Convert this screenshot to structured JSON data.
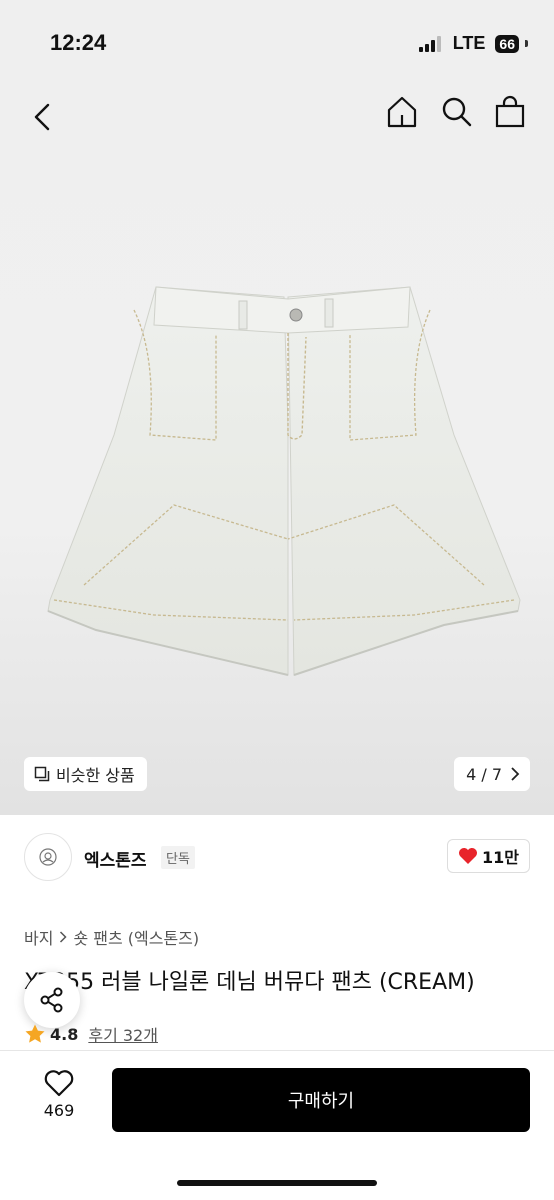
{
  "status_bar": {
    "time": "12:24",
    "network": "LTE",
    "battery": "66"
  },
  "nav": {
    "back_icon": "chevron-left-icon",
    "home_icon": "home-icon",
    "search_icon": "search-icon",
    "cart_icon": "shopping-bag-icon"
  },
  "gallery": {
    "similar_label": "비슷한 상품",
    "page_indicator": "4 / 7",
    "current": 4,
    "total": 7
  },
  "brand": {
    "name": "엑스톤즈",
    "tag": "단독",
    "likes": "11만"
  },
  "breadcrumb": {
    "category": "바지",
    "subcategory": "숏 팬츠 (엑스톤즈)"
  },
  "product": {
    "title": "XT355 러블 나일론 데님 버뮤다 팬츠 (CREAM)",
    "rating": "4.8",
    "reviews": "후기 32개"
  },
  "bottom_bar": {
    "wish_count": "469",
    "buy_label": "구매하기"
  },
  "colors": {
    "accent": "#000000",
    "heart": "#e8242b",
    "star": "#f5a623"
  }
}
